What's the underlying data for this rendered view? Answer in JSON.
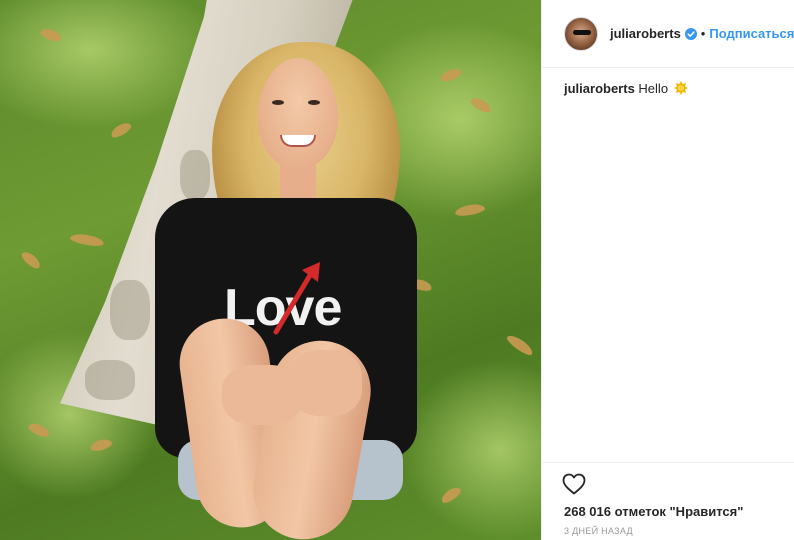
{
  "post": {
    "photo": {
      "sweater_text": "Love"
    },
    "header": {
      "username": "juliaroberts",
      "verified_icon": "verified-badge-icon",
      "separator": "•",
      "follow_label": "Подписаться"
    },
    "caption": {
      "username": "juliaroberts",
      "text": "Hello",
      "emoji_icon": "sun-emoji-icon"
    },
    "actions": {
      "like_icon": "heart-icon",
      "likes_text": "268 016 отметок \"Нравится\"",
      "timestamp": "3 ДНЕЙ НАЗАД"
    }
  },
  "colors": {
    "link_blue": "#3897f0",
    "text_dark": "#262626",
    "muted": "#999999",
    "border": "#efefef"
  }
}
